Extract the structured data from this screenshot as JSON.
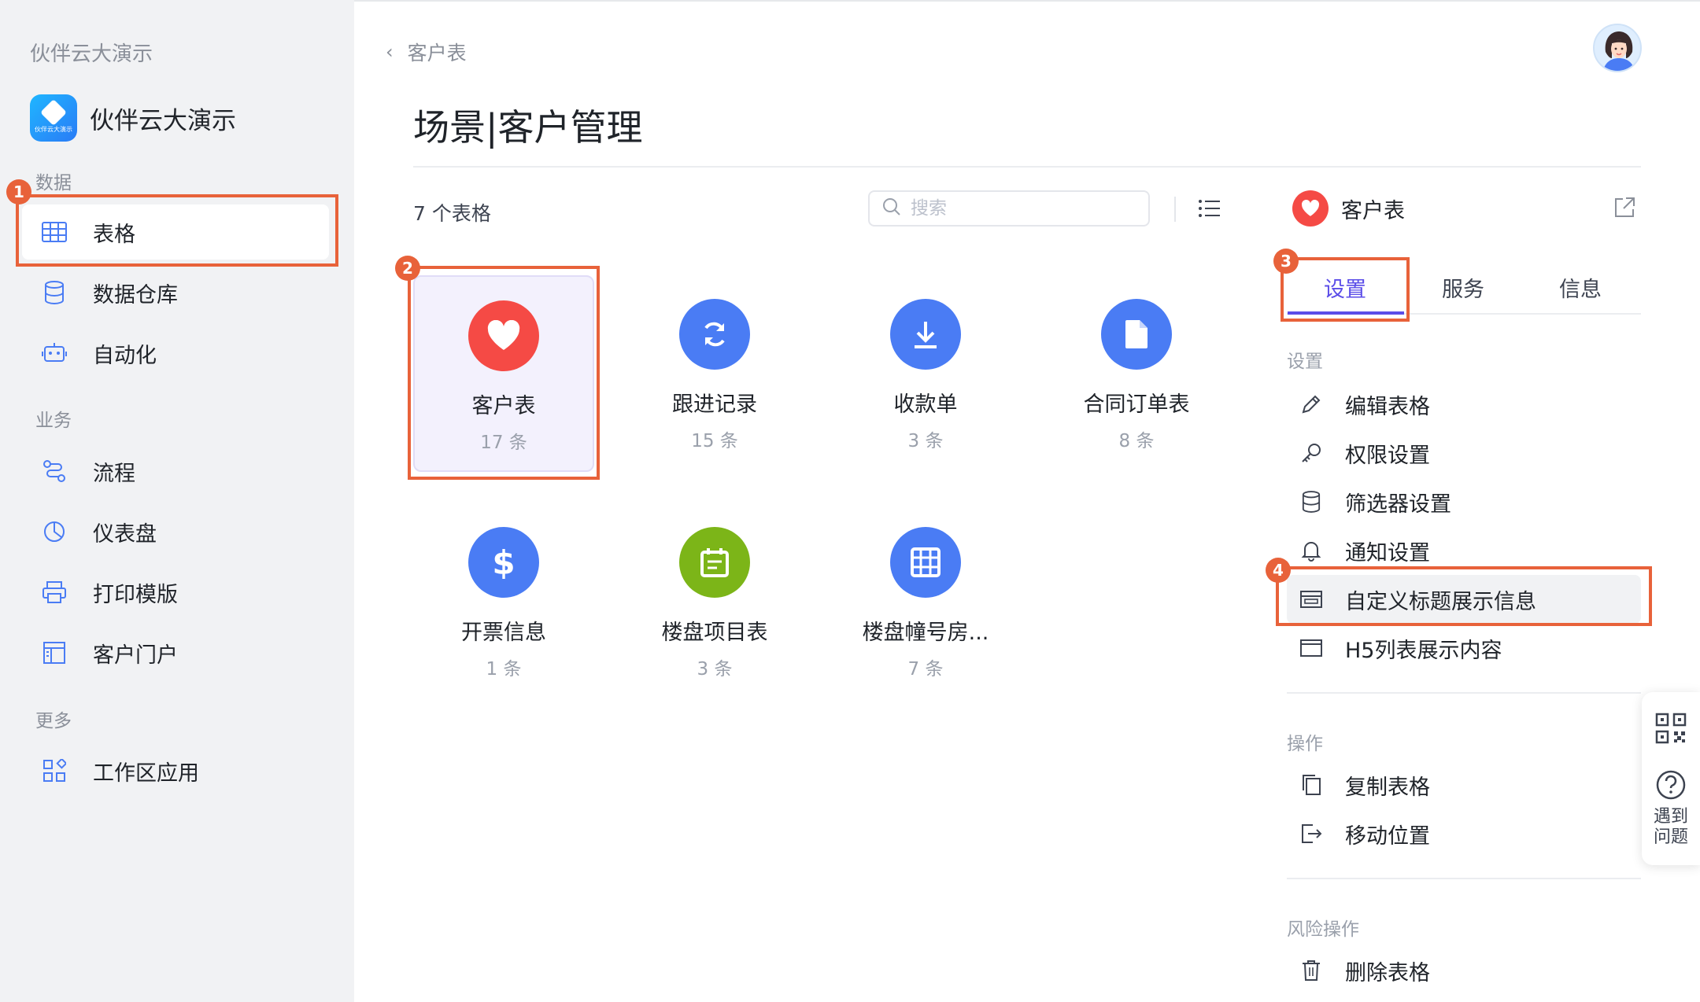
{
  "sidebar": {
    "workspace_title": "伙伴云大演示",
    "app_name": "伙伴云大演示",
    "app_logo_text": "伙伴云大演示",
    "sections": {
      "data": "数据",
      "business": "业务",
      "more": "更多"
    },
    "items": [
      {
        "label": "表格",
        "icon": "table-icon",
        "active": true
      },
      {
        "label": "数据仓库",
        "icon": "database-icon"
      },
      {
        "label": "自动化",
        "icon": "robot-icon"
      },
      {
        "label": "流程",
        "icon": "workflow-icon"
      },
      {
        "label": "仪表盘",
        "icon": "dashboard-icon"
      },
      {
        "label": "打印模版",
        "icon": "printer-icon"
      },
      {
        "label": "客户门户",
        "icon": "portal-icon"
      },
      {
        "label": "工作区应用",
        "icon": "apps-icon"
      }
    ]
  },
  "header": {
    "back_label": "客户表",
    "page_title": "场景|客户管理"
  },
  "toolbar": {
    "table_count": "7 个表格",
    "search_placeholder": "搜索"
  },
  "tables": [
    {
      "name": "客户表",
      "count": "17 条",
      "icon": "heart-icon",
      "color": "#f54a45"
    },
    {
      "name": "跟进记录",
      "count": "15 条",
      "icon": "sync-icon",
      "color": "#4a7cf4"
    },
    {
      "name": "收款单",
      "count": "3 条",
      "icon": "download-icon",
      "color": "#4a7cf4"
    },
    {
      "name": "合同订单表",
      "count": "8 条",
      "icon": "file-icon",
      "color": "#4a7cf4"
    },
    {
      "name": "开票信息",
      "count": "1 条",
      "icon": "dollar-icon",
      "color": "#4a7cf4"
    },
    {
      "name": "楼盘项目表",
      "count": "3 条",
      "icon": "calendar-icon",
      "color": "#7cb518"
    },
    {
      "name": "楼盘幢号房...",
      "count": "7 条",
      "icon": "grid-icon",
      "color": "#4a7cf4"
    }
  ],
  "panel": {
    "title": "客户表",
    "tabs": [
      "设置",
      "服务",
      "信息"
    ],
    "groups": {
      "settings": "设置",
      "operations": "操作",
      "danger": "风险操作"
    },
    "settings_items": [
      {
        "label": "编辑表格",
        "icon": "pencil-icon"
      },
      {
        "label": "权限设置",
        "icon": "key-icon"
      },
      {
        "label": "筛选器设置",
        "icon": "database-icon"
      },
      {
        "label": "通知设置",
        "icon": "bell-icon"
      },
      {
        "label": "自定义标题展示信息",
        "icon": "title-card-icon"
      },
      {
        "label": "H5列表展示内容",
        "icon": "window-icon"
      }
    ],
    "operation_items": [
      {
        "label": "复制表格",
        "icon": "copy-icon"
      },
      {
        "label": "移动位置",
        "icon": "move-icon"
      }
    ],
    "danger_items": [
      {
        "label": "删除表格",
        "icon": "trash-icon"
      }
    ]
  },
  "floating": {
    "help_label": "遇到问题"
  },
  "annotations": [
    "1",
    "2",
    "3",
    "4"
  ],
  "colors": {
    "accent": "#5b4de8",
    "annotation": "#e8623a",
    "brand_blue": "#4a7cf4",
    "brand_red": "#f54a45"
  }
}
